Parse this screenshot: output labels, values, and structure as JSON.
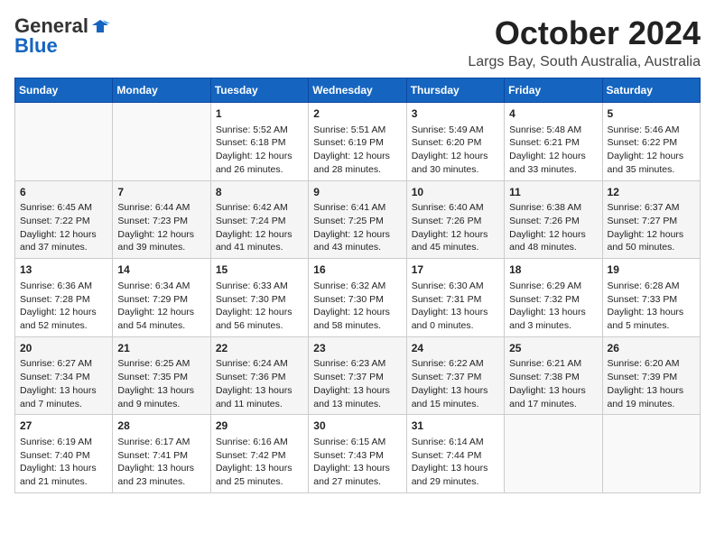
{
  "header": {
    "logo_general": "General",
    "logo_blue": "Blue",
    "month_title": "October 2024",
    "location": "Largs Bay, South Australia, Australia"
  },
  "days_of_week": [
    "Sunday",
    "Monday",
    "Tuesday",
    "Wednesday",
    "Thursday",
    "Friday",
    "Saturday"
  ],
  "weeks": [
    [
      {
        "day": "",
        "sunrise": "",
        "sunset": "",
        "daylight": ""
      },
      {
        "day": "",
        "sunrise": "",
        "sunset": "",
        "daylight": ""
      },
      {
        "day": "1",
        "sunrise": "Sunrise: 5:52 AM",
        "sunset": "Sunset: 6:18 PM",
        "daylight": "Daylight: 12 hours and 26 minutes."
      },
      {
        "day": "2",
        "sunrise": "Sunrise: 5:51 AM",
        "sunset": "Sunset: 6:19 PM",
        "daylight": "Daylight: 12 hours and 28 minutes."
      },
      {
        "day": "3",
        "sunrise": "Sunrise: 5:49 AM",
        "sunset": "Sunset: 6:20 PM",
        "daylight": "Daylight: 12 hours and 30 minutes."
      },
      {
        "day": "4",
        "sunrise": "Sunrise: 5:48 AM",
        "sunset": "Sunset: 6:21 PM",
        "daylight": "Daylight: 12 hours and 33 minutes."
      },
      {
        "day": "5",
        "sunrise": "Sunrise: 5:46 AM",
        "sunset": "Sunset: 6:22 PM",
        "daylight": "Daylight: 12 hours and 35 minutes."
      }
    ],
    [
      {
        "day": "6",
        "sunrise": "Sunrise: 6:45 AM",
        "sunset": "Sunset: 7:22 PM",
        "daylight": "Daylight: 12 hours and 37 minutes."
      },
      {
        "day": "7",
        "sunrise": "Sunrise: 6:44 AM",
        "sunset": "Sunset: 7:23 PM",
        "daylight": "Daylight: 12 hours and 39 minutes."
      },
      {
        "day": "8",
        "sunrise": "Sunrise: 6:42 AM",
        "sunset": "Sunset: 7:24 PM",
        "daylight": "Daylight: 12 hours and 41 minutes."
      },
      {
        "day": "9",
        "sunrise": "Sunrise: 6:41 AM",
        "sunset": "Sunset: 7:25 PM",
        "daylight": "Daylight: 12 hours and 43 minutes."
      },
      {
        "day": "10",
        "sunrise": "Sunrise: 6:40 AM",
        "sunset": "Sunset: 7:26 PM",
        "daylight": "Daylight: 12 hours and 45 minutes."
      },
      {
        "day": "11",
        "sunrise": "Sunrise: 6:38 AM",
        "sunset": "Sunset: 7:26 PM",
        "daylight": "Daylight: 12 hours and 48 minutes."
      },
      {
        "day": "12",
        "sunrise": "Sunrise: 6:37 AM",
        "sunset": "Sunset: 7:27 PM",
        "daylight": "Daylight: 12 hours and 50 minutes."
      }
    ],
    [
      {
        "day": "13",
        "sunrise": "Sunrise: 6:36 AM",
        "sunset": "Sunset: 7:28 PM",
        "daylight": "Daylight: 12 hours and 52 minutes."
      },
      {
        "day": "14",
        "sunrise": "Sunrise: 6:34 AM",
        "sunset": "Sunset: 7:29 PM",
        "daylight": "Daylight: 12 hours and 54 minutes."
      },
      {
        "day": "15",
        "sunrise": "Sunrise: 6:33 AM",
        "sunset": "Sunset: 7:30 PM",
        "daylight": "Daylight: 12 hours and 56 minutes."
      },
      {
        "day": "16",
        "sunrise": "Sunrise: 6:32 AM",
        "sunset": "Sunset: 7:30 PM",
        "daylight": "Daylight: 12 hours and 58 minutes."
      },
      {
        "day": "17",
        "sunrise": "Sunrise: 6:30 AM",
        "sunset": "Sunset: 7:31 PM",
        "daylight": "Daylight: 13 hours and 0 minutes."
      },
      {
        "day": "18",
        "sunrise": "Sunrise: 6:29 AM",
        "sunset": "Sunset: 7:32 PM",
        "daylight": "Daylight: 13 hours and 3 minutes."
      },
      {
        "day": "19",
        "sunrise": "Sunrise: 6:28 AM",
        "sunset": "Sunset: 7:33 PM",
        "daylight": "Daylight: 13 hours and 5 minutes."
      }
    ],
    [
      {
        "day": "20",
        "sunrise": "Sunrise: 6:27 AM",
        "sunset": "Sunset: 7:34 PM",
        "daylight": "Daylight: 13 hours and 7 minutes."
      },
      {
        "day": "21",
        "sunrise": "Sunrise: 6:25 AM",
        "sunset": "Sunset: 7:35 PM",
        "daylight": "Daylight: 13 hours and 9 minutes."
      },
      {
        "day": "22",
        "sunrise": "Sunrise: 6:24 AM",
        "sunset": "Sunset: 7:36 PM",
        "daylight": "Daylight: 13 hours and 11 minutes."
      },
      {
        "day": "23",
        "sunrise": "Sunrise: 6:23 AM",
        "sunset": "Sunset: 7:37 PM",
        "daylight": "Daylight: 13 hours and 13 minutes."
      },
      {
        "day": "24",
        "sunrise": "Sunrise: 6:22 AM",
        "sunset": "Sunset: 7:37 PM",
        "daylight": "Daylight: 13 hours and 15 minutes."
      },
      {
        "day": "25",
        "sunrise": "Sunrise: 6:21 AM",
        "sunset": "Sunset: 7:38 PM",
        "daylight": "Daylight: 13 hours and 17 minutes."
      },
      {
        "day": "26",
        "sunrise": "Sunrise: 6:20 AM",
        "sunset": "Sunset: 7:39 PM",
        "daylight": "Daylight: 13 hours and 19 minutes."
      }
    ],
    [
      {
        "day": "27",
        "sunrise": "Sunrise: 6:19 AM",
        "sunset": "Sunset: 7:40 PM",
        "daylight": "Daylight: 13 hours and 21 minutes."
      },
      {
        "day": "28",
        "sunrise": "Sunrise: 6:17 AM",
        "sunset": "Sunset: 7:41 PM",
        "daylight": "Daylight: 13 hours and 23 minutes."
      },
      {
        "day": "29",
        "sunrise": "Sunrise: 6:16 AM",
        "sunset": "Sunset: 7:42 PM",
        "daylight": "Daylight: 13 hours and 25 minutes."
      },
      {
        "day": "30",
        "sunrise": "Sunrise: 6:15 AM",
        "sunset": "Sunset: 7:43 PM",
        "daylight": "Daylight: 13 hours and 27 minutes."
      },
      {
        "day": "31",
        "sunrise": "Sunrise: 6:14 AM",
        "sunset": "Sunset: 7:44 PM",
        "daylight": "Daylight: 13 hours and 29 minutes."
      },
      {
        "day": "",
        "sunrise": "",
        "sunset": "",
        "daylight": ""
      },
      {
        "day": "",
        "sunrise": "",
        "sunset": "",
        "daylight": ""
      }
    ]
  ]
}
